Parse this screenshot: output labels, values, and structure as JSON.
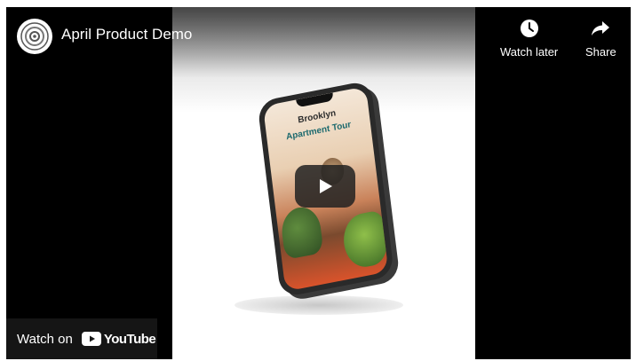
{
  "video": {
    "title": "April Product Demo",
    "screen_line1": "Brooklyn",
    "screen_line2": "Apartment Tour"
  },
  "actions": {
    "watch_later_label": "Watch later",
    "share_label": "Share"
  },
  "footer": {
    "watch_on_label": "Watch on",
    "brand_label": "YouTube"
  },
  "icons": {
    "avatar": "channel-avatar-icon",
    "watch_later": "clock-icon",
    "share": "share-arrow-icon",
    "play": "play-icon",
    "youtube": "youtube-logo-icon"
  },
  "colors": {
    "background": "#000000",
    "brand_red": "#ff0000",
    "text": "#ffffff",
    "play_button_bg": "#212121"
  }
}
